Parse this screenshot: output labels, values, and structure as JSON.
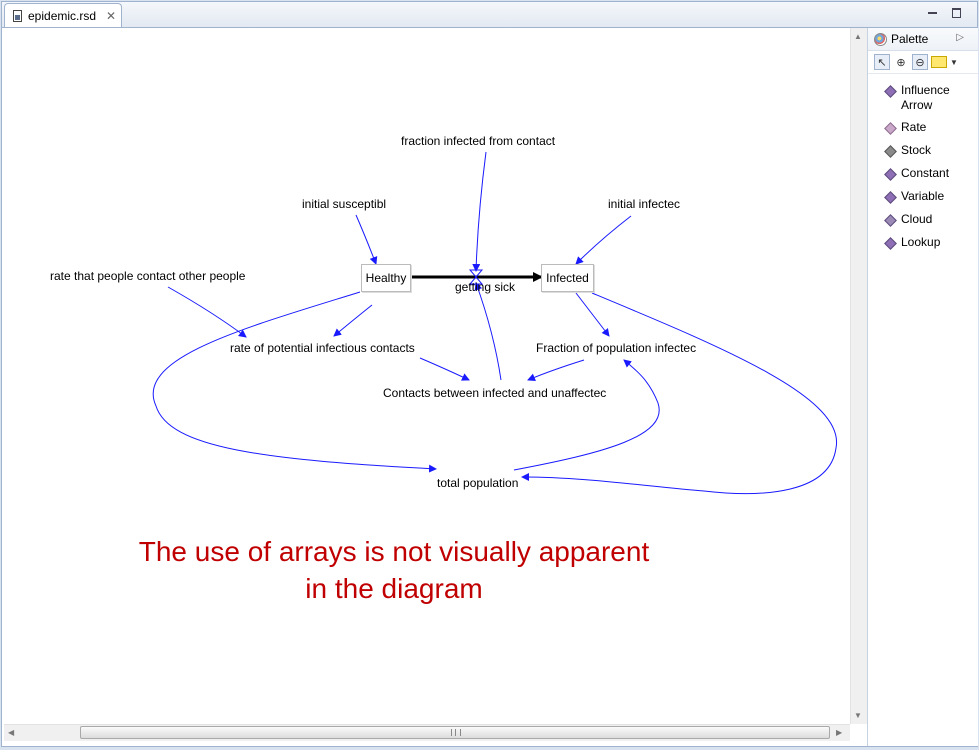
{
  "editor": {
    "tab_title": "epidemic.rsd"
  },
  "diagram": {
    "stocks": {
      "healthy": "Healthy",
      "infected": "Infected"
    },
    "rate": "getting sick",
    "variables": {
      "fraction_infected": "fraction infected from contact",
      "initial_susceptible": "initial susceptibl",
      "initial_infected": "initial infectec",
      "contact_rate": "rate that people contact other people",
      "potential_contacts": "rate of potential infectious contacts",
      "fraction_population": "Fraction of population infectec",
      "contacts_between": "Contacts between infected and unaffectec",
      "total_population": "total population"
    }
  },
  "annotation": {
    "line1": "The use of arrays is not visually apparent",
    "line2": "in the diagram",
    "color": "#c00000"
  },
  "palette": {
    "title": "Palette",
    "items": [
      {
        "label": "Influence Arrow",
        "icon": "influence-arrow-icon"
      },
      {
        "label": "Rate",
        "icon": "rate-icon"
      },
      {
        "label": "Stock",
        "icon": "stock-icon"
      },
      {
        "label": "Constant",
        "icon": "constant-icon"
      },
      {
        "label": "Variable",
        "icon": "variable-icon"
      },
      {
        "label": "Cloud",
        "icon": "cloud-icon"
      },
      {
        "label": "Lookup",
        "icon": "lookup-icon"
      }
    ]
  },
  "colors": {
    "influence": "#1a1aff",
    "flow": "#000000",
    "frame": "#9fb3cf"
  }
}
